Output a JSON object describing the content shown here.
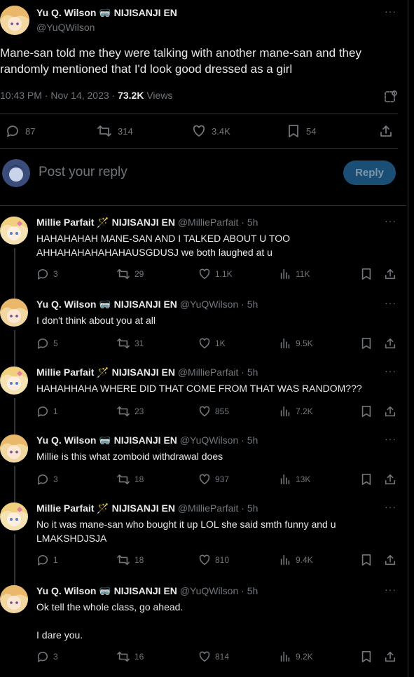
{
  "main_tweet": {
    "name": "Yu Q. Wilson 🥽 NIJISANJI EN",
    "handle": "@YuQWilson",
    "text": "Mane-san told me they were talking with another mane-san and they randomly mentioned that I'd look good dressed as a girl",
    "time": "10:43 PM · Nov 14, 2023 · ",
    "views_count": "73.2K",
    "views_label": " Views",
    "replies": "87",
    "reposts": "314",
    "likes": "3.4K",
    "bookmarks": "54"
  },
  "reply_box": {
    "placeholder": "Post your reply",
    "button": "Reply"
  },
  "replies": [
    {
      "name": "Millie Parfait 🪄 NIJISANJI EN",
      "meta": " @MillieParfait · 5h",
      "text": "HAHAHAHAH MANE-SAN AND I TALKED ABOUT U TOO AHHAHAHAHAHAHAUSGDUSJ we both laughed at u",
      "replies": "3",
      "reposts": "29",
      "likes": "1.1K",
      "views": "11K"
    },
    {
      "name": "Yu Q. Wilson 🥽 NIJISANJI EN",
      "meta": " @YuQWilson · 5h",
      "text": "I don't think about you at all",
      "replies": "5",
      "reposts": "31",
      "likes": "1K",
      "views": "9.5K"
    },
    {
      "name": "Millie Parfait 🪄 NIJISANJI EN",
      "meta": " @MillieParfait · 5h",
      "text": "HAHAHHAHA WHERE DID THAT COME FROM THAT WAS RANDOM???",
      "replies": "1",
      "reposts": "23",
      "likes": "855",
      "views": "7.2K"
    },
    {
      "name": "Yu Q. Wilson 🥽 NIJISANJI EN",
      "meta": " @YuQWilson · 5h",
      "text": "Millie is this what zomboid withdrawal does",
      "replies": "3",
      "reposts": "18",
      "likes": "937",
      "views": "13K"
    },
    {
      "name": "Millie Parfait 🪄 NIJISANJI EN",
      "meta": " @MillieParfait · 5h",
      "text": "No it was mane-san who bought it up LOL she said smth funny and u LMAKSHDJSJA",
      "replies": "1",
      "reposts": "18",
      "likes": "810",
      "views": "9.4K"
    },
    {
      "name": "Yu Q. Wilson 🥽 NIJISANJI EN",
      "meta": " @YuQWilson · 5h",
      "text": "Ok tell the whole class, go ahead.",
      "text2": "I dare you.",
      "replies": "3",
      "reposts": "16",
      "likes": "814",
      "views": "9.2K"
    }
  ],
  "colors": {
    "background": "#000000",
    "text": "#e7e9ea",
    "muted": "#71767b",
    "accent": "#1d9bf0",
    "divider": "#2f3336"
  }
}
